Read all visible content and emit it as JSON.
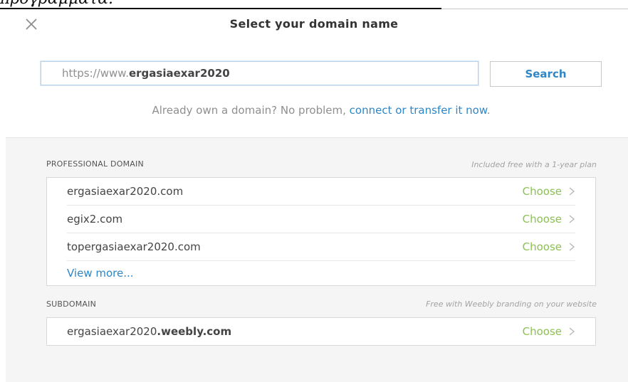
{
  "page_top_text": "προγράμματα.",
  "dialog": {
    "title": "Select your domain name",
    "close_icon": "close-icon"
  },
  "search": {
    "prefix": "https://www.",
    "value": "ergasiaexar2020",
    "button_label": "Search"
  },
  "already_own": {
    "text": "Already own a domain? No problem, ",
    "link": "connect or transfer it now",
    "suffix": "."
  },
  "professional": {
    "label": "PROFESSIONAL DOMAIN",
    "note": "Included free with a 1-year plan",
    "items": [
      {
        "name": "ergasiaexar2020.com",
        "action": "Choose"
      },
      {
        "name": "egix2.com",
        "action": "Choose"
      },
      {
        "name": "topergasiaexar2020.com",
        "action": "Choose"
      }
    ],
    "view_more": "View more..."
  },
  "subdomain": {
    "label": "SUBDOMAIN",
    "note": "Free with Weebly branding on your website",
    "name_main": "ergasiaexar2020",
    "name_suffix": ".weebly.com",
    "action": "Choose"
  },
  "colors": {
    "link_blue": "#2f86c6",
    "choose_green": "#8cc152",
    "panel_gray": "#f5f5f5"
  },
  "icons": {
    "chevron": "chevron-right-icon"
  }
}
